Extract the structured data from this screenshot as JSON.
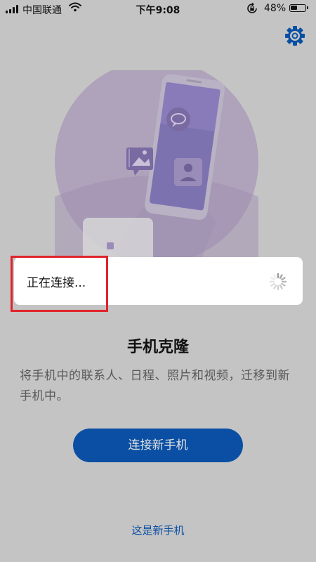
{
  "status_bar": {
    "carrier": "中国联通",
    "time": "下午9:08",
    "battery_percent": "48%",
    "battery_level": 0.48,
    "signal_bars": 4
  },
  "header": {
    "settings_icon": "gear-icon",
    "accent_color": "#0a4fa3"
  },
  "dialog": {
    "message": "正在连接...",
    "loading_icon": "spinner-icon",
    "highlight_color": "#e0242b"
  },
  "main": {
    "title": "手机克隆",
    "description": "将手机中的联系人、日程、照片和视频，迁移到新手机中。",
    "connect_button_label": "连接新手机",
    "new_phone_link": "这是新手机"
  }
}
